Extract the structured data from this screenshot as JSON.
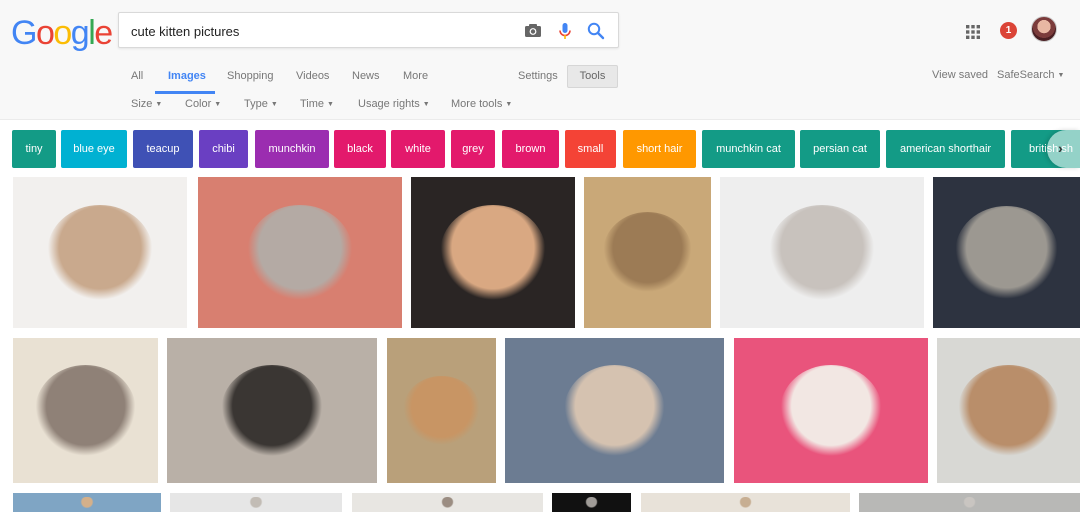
{
  "logo": {
    "letters": [
      "G",
      "o",
      "o",
      "g",
      "l",
      "e"
    ],
    "colors": [
      "#4285f4",
      "#ea4335",
      "#fbbc05",
      "#4285f4",
      "#34a853",
      "#ea4335"
    ]
  },
  "search": {
    "query": "cute kitten pictures",
    "camera_icon": "camera-icon",
    "mic_icon": "microphone-icon",
    "search_icon": "search-icon"
  },
  "account": {
    "apps_icon": "apps-grid-icon",
    "notification_count": "1",
    "avatar": "user-avatar"
  },
  "tabs": [
    "All",
    "Images",
    "Shopping",
    "Videos",
    "News",
    "More"
  ],
  "active_tab": "Images",
  "settings_label": "Settings",
  "tools_label": "Tools",
  "view_saved_label": "View saved",
  "safesearch_label": "SafeSearch",
  "filters": [
    "Size",
    "Color",
    "Type",
    "Time",
    "Usage rights",
    "More tools"
  ],
  "chips": [
    {
      "label": "tiny",
      "color": "#139b86"
    },
    {
      "label": "blue eye",
      "color": "#00b1d2"
    },
    {
      "label": "teacup",
      "color": "#3f51b5"
    },
    {
      "label": "chibi",
      "color": "#6a3fc2"
    },
    {
      "label": "munchkin",
      "color": "#9b2db0"
    },
    {
      "label": "black",
      "color": "#e3196c"
    },
    {
      "label": "white",
      "color": "#e3196c"
    },
    {
      "label": "grey",
      "color": "#e3196c"
    },
    {
      "label": "brown",
      "color": "#e3196c"
    },
    {
      "label": "small",
      "color": "#f44336"
    },
    {
      "label": "short hair",
      "color": "#ff9800"
    },
    {
      "label": "munchkin cat",
      "color": "#139b86"
    },
    {
      "label": "persian cat",
      "color": "#139b86"
    },
    {
      "label": "american shorthair",
      "color": "#139b86"
    },
    {
      "label": "british sh",
      "color": "#139b86"
    }
  ],
  "next_icon": "chevron-right-icon",
  "results": {
    "thumbnail_tones": [
      {
        "bg": "#f2f0ee",
        "fur": "#c9a98d"
      },
      {
        "bg": "#d87f70",
        "fur": "#b4aaa4"
      },
      {
        "bg": "#2a2524",
        "fur": "#d9a882"
      },
      {
        "bg": "#c9a878",
        "fur": "#9c7b55"
      },
      {
        "bg": "#eeeeee",
        "fur": "#c8c2bd"
      },
      {
        "bg": "#2d3340",
        "fur": "#9c9891"
      },
      {
        "bg": "#e9e1d3",
        "fur": "#8f8177"
      },
      {
        "bg": "#b9b0a7",
        "fur": "#3a3633"
      },
      {
        "bg": "#b9a07a",
        "fur": "#c89564"
      },
      {
        "bg": "#6c7c92",
        "fur": "#d5c2b0"
      },
      {
        "bg": "#e9547c",
        "fur": "#f2e7e3"
      },
      {
        "bg": "#d8d8d4",
        "fur": "#b98e6a"
      },
      {
        "bg": "#7fa5c4",
        "fur": "#d4b08a"
      },
      {
        "bg": "#e6e6e6",
        "fur": "#c2bcb5"
      },
      {
        "bg": "#e8e6e2",
        "fur": "#9b8d82"
      },
      {
        "bg": "#111111",
        "fur": "#a09c98"
      },
      {
        "bg": "#e8e2d9",
        "fur": "#c7ae92"
      },
      {
        "bg": "#b8b8b6",
        "fur": "#c9c5c1"
      }
    ]
  }
}
